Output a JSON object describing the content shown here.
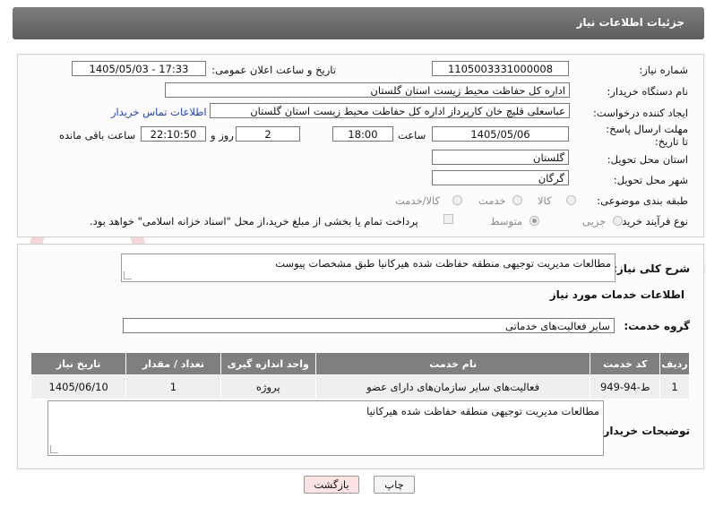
{
  "header": {
    "title": "جزئیات اطلاعات نیاز"
  },
  "fields": {
    "need_number_label": "شماره نیاز:",
    "need_number": "1105003331000008",
    "announce_label": "تاریخ و ساعت اعلان عمومی:",
    "announce_value": "1405/05/03 - 17:33",
    "buyer_org_label": "نام دستگاه خریدار:",
    "buyer_org": "اداره کل حفاظت محیط زیست استان گلستان",
    "requester_label": "ایجاد کننده درخواست:",
    "requester": "عباسعلی  قلیچ خان  کارپرداز اداره کل حفاظت محیط زیست استان گلستان",
    "contact_link": "اطلاعات تماس خریدار",
    "deadline_label": "مهلت ارسال پاسخ: تا تاریخ:",
    "deadline_date": "1405/05/06",
    "time_label": "ساعت",
    "deadline_time": "18:00",
    "days_value": "2",
    "days_label": "روز و",
    "remaining_value": "22:10:50",
    "remaining_label": "ساعت باقی مانده",
    "province_label": "استان محل تحویل:",
    "province": "گلستان",
    "city_label": "شهر محل تحویل:",
    "city": "گرگان",
    "category_label": "طبقه بندی موضوعی:",
    "category_options": [
      "کالا",
      "خدمت",
      "کالا/خدمت"
    ],
    "process_label": "نوع فرآیند خرید :",
    "process_options": [
      "جزیی",
      "متوسط"
    ],
    "payment_note": "پرداخت تمام یا بخشی از مبلغ خرید،از محل \"اسناد خزانه اسلامی\" خواهد بود."
  },
  "summary": {
    "label": "شرح کلی نیاز:",
    "value": "مطالعات مدیریت توجیهی منطقه حفاظت شده هیرکانیا طبق مشخصات پیوست"
  },
  "services": {
    "section_title": "اطلاعات خدمات مورد نیاز",
    "group_label": "گروه خدمت:",
    "group_value": "سایر فعالیت‌های خدماتی",
    "columns": [
      "ردیف",
      "کد خدمت",
      "نام خدمت",
      "واحد اندازه گیری",
      "تعداد / مقدار",
      "تاریخ نیاز"
    ],
    "rows": [
      [
        "1",
        "ط-94-949",
        "فعالیت‌های سایر سازمان‌های دارای عضو",
        "پروژه",
        "1",
        "1405/06/10"
      ]
    ]
  },
  "buyer_notes": {
    "label": "توضیحات خریدار:",
    "value": "مطالعات مدیریت توجیهی منطقه حفاظت شده هیرکانیا"
  },
  "buttons": {
    "print": "چاپ",
    "back": "بازگشت"
  },
  "colors": {
    "header_bg": "#6e6e6e",
    "table_header_bg": "#7f7f7f",
    "back_button_bg": "#fde4e4",
    "link": "#1a44c8"
  }
}
